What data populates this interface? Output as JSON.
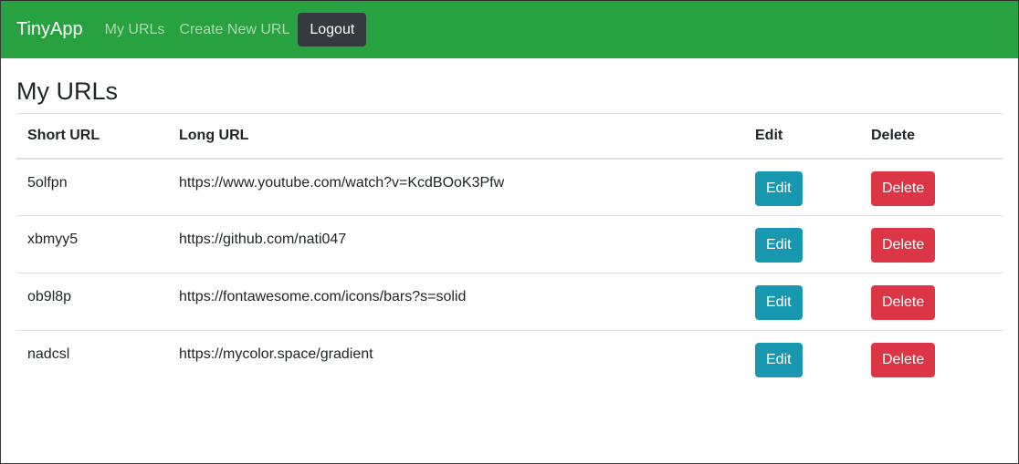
{
  "navbar": {
    "brand": "TinyApp",
    "links": [
      "My URLs",
      "Create New URL"
    ],
    "logout_label": "Logout"
  },
  "main": {
    "title": "My URLs",
    "table": {
      "headers": [
        "Short URL",
        "Long URL",
        "Edit",
        "Delete"
      ],
      "rows": [
        {
          "short": "5olfpn",
          "long": "https://www.youtube.com/watch?v=KcdBOoK3Pfw",
          "edit": "Edit",
          "delete": "Delete"
        },
        {
          "short": "xbmyy5",
          "long": "https://github.com/nati047",
          "edit": "Edit",
          "delete": "Delete"
        },
        {
          "short": "ob9l8p",
          "long": "https://fontawesome.com/icons/bars?s=solid",
          "edit": "Edit",
          "delete": "Delete"
        },
        {
          "short": "nadcsl",
          "long": "https://mycolor.space/gradient",
          "edit": "Edit",
          "delete": "Delete"
        }
      ]
    }
  },
  "colors": {
    "navbar": "#28a140",
    "edit_button": "#1798b0",
    "delete_button": "#dc3545",
    "logout_button": "#343a40"
  }
}
